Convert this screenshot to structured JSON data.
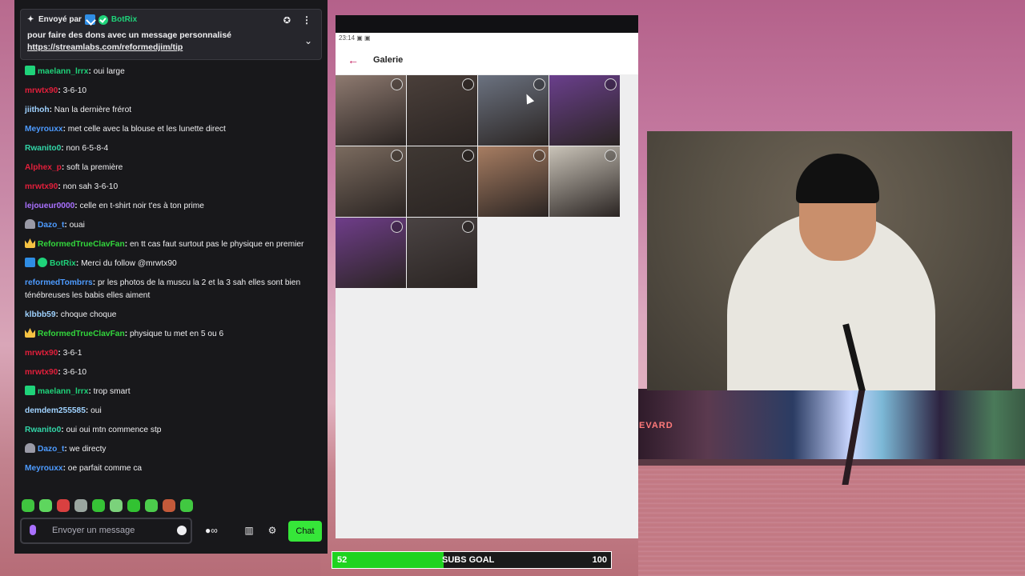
{
  "pinned": {
    "sent_by": "Envoyé par",
    "bot_name": "BotRix",
    "line1": "pour faire des dons avec un message personnalisé",
    "link": "https://streamlabs.com/reformedjim/tip"
  },
  "messages": [
    {
      "badge": "gift",
      "user": "maelann_lrrx",
      "color": "#1fd37a",
      "text": "oui large"
    },
    {
      "badge": "",
      "user": "mrwtx90",
      "color": "#e21f3b",
      "text": "3-6-10"
    },
    {
      "badge": "",
      "user": "jiithoh",
      "color": "#9fd2ff",
      "text": "Nan la dernière frérot"
    },
    {
      "badge": "",
      "user": "Meyrouxx",
      "color": "#4d9bff",
      "text": "met celle avec la blouse et les lunette direct"
    },
    {
      "badge": "",
      "user": "Rwanito0",
      "color": "#32d6a8",
      "text": "non 6-5-8-4"
    },
    {
      "badge": "",
      "user": "Alphex_p",
      "color": "#e21f3b",
      "text": "soft la première"
    },
    {
      "badge": "",
      "user": "mrwtx90",
      "color": "#e21f3b",
      "text": "non sah 3-6-10"
    },
    {
      "badge": "",
      "user": "lejoueur0000",
      "color": "#a970ff",
      "text": "celle en t-shirt noir t'es à ton prime"
    },
    {
      "badge": "ghost",
      "user": "Dazo_t",
      "color": "#4d9bff",
      "text": "ouai"
    },
    {
      "badge": "crown",
      "user": "ReformedTrueClavFan",
      "color": "#32d63c",
      "text": "en tt cas faut surtout pas le physique en premier"
    },
    {
      "badge": "bot",
      "user": "BotRix",
      "color": "#1fd37a",
      "text": "Merci du follow @mrwtx90"
    },
    {
      "badge": "",
      "user": "reformedTombrrs",
      "color": "#4d9bff",
      "text": "pr les photos de la muscu la 2 et la 3 sah elles sont bien ténébreuses les babis elles aiment"
    },
    {
      "badge": "",
      "user": "klbbb59",
      "color": "#9fd2ff",
      "text": "choque choque"
    },
    {
      "badge": "crown",
      "user": "ReformedTrueClavFan",
      "color": "#32d63c",
      "text": "physique tu met en 5 ou 6"
    },
    {
      "badge": "",
      "user": "mrwtx90",
      "color": "#e21f3b",
      "text": "3-6-1"
    },
    {
      "badge": "",
      "user": "mrwtx90",
      "color": "#e21f3b",
      "text": "3-6-10"
    },
    {
      "badge": "gift",
      "user": "maelann_lrrx",
      "color": "#1fd37a",
      "text": "trop smart"
    },
    {
      "badge": "",
      "user": "demdem255585",
      "color": "#9fd2ff",
      "text": "oui"
    },
    {
      "badge": "",
      "user": "Rwanito0",
      "color": "#32d6a8",
      "text": "oui oui mtn commence stp"
    },
    {
      "badge": "ghost",
      "user": "Dazo_t",
      "color": "#4d9bff",
      "text": "we directy"
    },
    {
      "badge": "",
      "user": "Meyrouxx",
      "color": "#4d9bff",
      "text": "oe parfait comme ca"
    }
  ],
  "emote_colors": [
    "#3fc53f",
    "#5ed65e",
    "#d94040",
    "#9aa6a0",
    "#36c236",
    "#7bd27b",
    "#32c232",
    "#4ccc4c",
    "#c45a3a",
    "#41c841"
  ],
  "chat_input": {
    "placeholder": "Envoyer un message",
    "send_label": "Chat"
  },
  "phone": {
    "time": "23:14",
    "title": "Galerie",
    "thumb_colors": [
      "#8e7a70",
      "#4a3f3a",
      "#6b7280",
      "#6a3f8c",
      "#7b6b5f",
      "#3f3833",
      "#a77d62",
      "#c9c3b8",
      "#6f3d8a",
      "#4a4343"
    ]
  },
  "goal": {
    "start": "52",
    "label": "SUBS GOAL",
    "end": "100",
    "progress": 0.4
  },
  "scene_sign": "EVARD"
}
